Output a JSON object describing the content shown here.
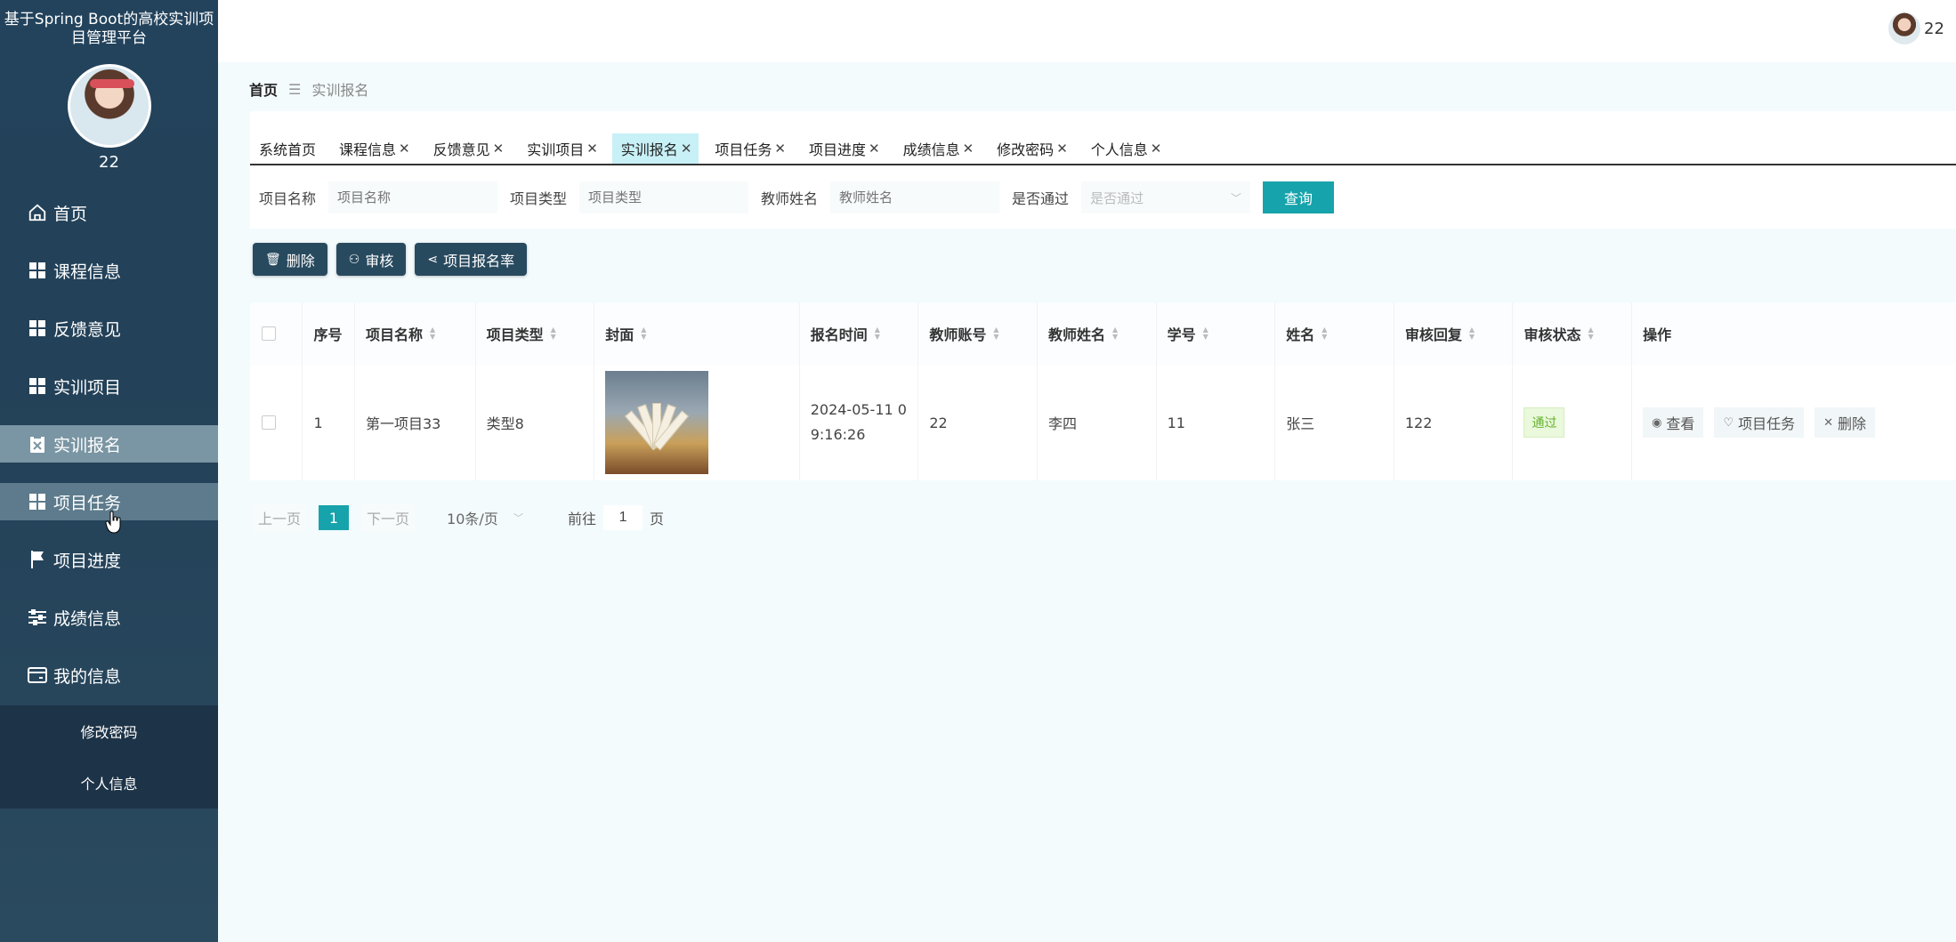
{
  "app": {
    "title": "基于Spring Boot的高校实训项目管理平台",
    "user": "22"
  },
  "sidebar": {
    "items": [
      {
        "label": "首页",
        "icon": "home-icon"
      },
      {
        "label": "课程信息",
        "icon": "grid-icon"
      },
      {
        "label": "反馈意见",
        "icon": "grid-icon"
      },
      {
        "label": "实训项目",
        "icon": "grid-icon"
      },
      {
        "label": "实训报名",
        "icon": "clipboard-icon"
      },
      {
        "label": "项目任务",
        "icon": "grid-icon"
      },
      {
        "label": "项目进度",
        "icon": "flag-icon"
      },
      {
        "label": "成绩信息",
        "icon": "sliders-icon"
      },
      {
        "label": "我的信息",
        "icon": "card-icon"
      }
    ],
    "submenu": [
      "修改密码",
      "个人信息"
    ]
  },
  "topbar": {
    "user": "22"
  },
  "breadcrumb": {
    "home": "首页",
    "current": "实训报名"
  },
  "tabs": [
    {
      "label": "系统首页",
      "closable": false
    },
    {
      "label": "课程信息",
      "closable": true
    },
    {
      "label": "反馈意见",
      "closable": true
    },
    {
      "label": "实训项目",
      "closable": true
    },
    {
      "label": "实训报名",
      "closable": true
    },
    {
      "label": "项目任务",
      "closable": true
    },
    {
      "label": "项目进度",
      "closable": true
    },
    {
      "label": "成绩信息",
      "closable": true
    },
    {
      "label": "修改密码",
      "closable": true
    },
    {
      "label": "个人信息",
      "closable": true
    }
  ],
  "search": {
    "project_name_label": "项目名称",
    "project_name_placeholder": "项目名称",
    "project_type_label": "项目类型",
    "project_type_placeholder": "项目类型",
    "teacher_name_label": "教师姓名",
    "teacher_name_placeholder": "教师姓名",
    "passed_label": "是否通过",
    "passed_placeholder": "是否通过",
    "query_button": "查询"
  },
  "actions": {
    "delete": "删除",
    "review": "审核",
    "rate": "项目报名率"
  },
  "table": {
    "headers": [
      "序号",
      "项目名称",
      "项目类型",
      "封面",
      "报名时间",
      "教师账号",
      "教师姓名",
      "学号",
      "姓名",
      "审核回复",
      "审核状态",
      "操作"
    ],
    "rows": [
      {
        "index": "1",
        "project_name": "第一项目33",
        "project_type": "类型8",
        "time_line1": "2024-05-11 0",
        "time_line2": "9:16:26",
        "teacher_account": "22",
        "teacher_name": "李四",
        "student_id": "11",
        "name": "张三",
        "reply": "122",
        "status": "通过",
        "op_view": "查看",
        "op_task": "项目任务",
        "op_delete": "删除"
      }
    ]
  },
  "pager": {
    "prev": "上一页",
    "current": "1",
    "next": "下一页",
    "size": "10条/页",
    "goto": "前往",
    "goto_value": "1",
    "unit": "页"
  }
}
